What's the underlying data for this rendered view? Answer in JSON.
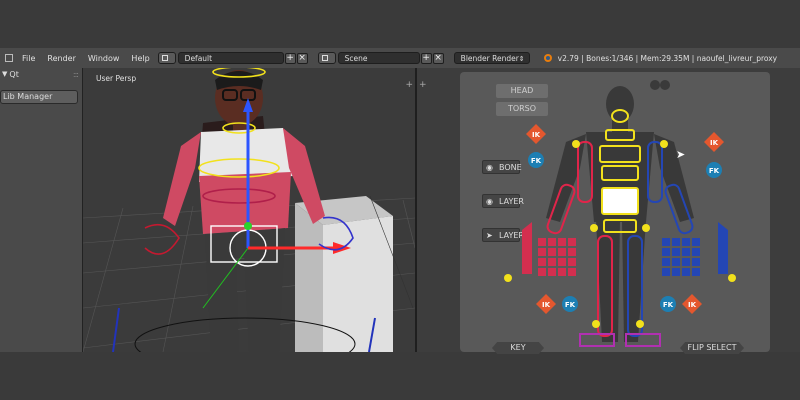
{
  "menu": {
    "file": "File",
    "render": "Render",
    "window": "Window",
    "help": "Help"
  },
  "header": {
    "layout": "Default",
    "scene": "Scene",
    "engine": "Blender Render",
    "stats": "v2.79 | Bones:1/346 | Mem:29.35M | naoufel_livreur_proxy"
  },
  "left_panel": {
    "title": "Qt",
    "lib_manager": "Lib Manager"
  },
  "viewport": {
    "label": "User Persp"
  },
  "picker": {
    "head": "HEAD",
    "torso": "TORSO",
    "bone": "BONE",
    "layer": "LAYER",
    "layer_tool": "LAYER",
    "ik": "IK",
    "fk": "FK",
    "key": "KEY",
    "flip_select": "FLIP SELECT"
  },
  "colors": {
    "left_side": "#e0254a",
    "right_side": "#2446b4",
    "center": "#ffe600",
    "ik": "#e4572e",
    "fk": "#1d7fb3"
  }
}
